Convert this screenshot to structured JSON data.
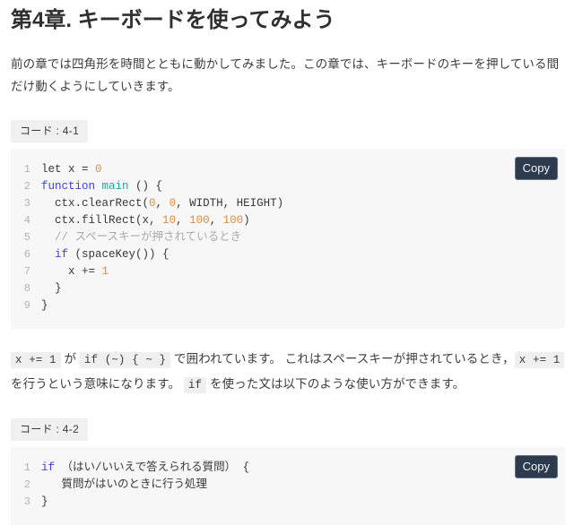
{
  "page": {
    "chapter_title": "第4章. キーボードを使ってみよう",
    "intro_paragraph": "前の章では四角形を時間とともに動かしてみました。この章では、キーボードのキーを押している間だけ動くようにしていきます。"
  },
  "code_blocks": [
    {
      "caption": "コード : 4-1",
      "copy_label": "Copy",
      "lines": [
        {
          "number": "1",
          "tokens": [
            {
              "text": "let x = ",
              "type": "plain"
            },
            {
              "text": "0",
              "type": "number"
            }
          ]
        },
        {
          "number": "2",
          "tokens": [
            {
              "text": "function",
              "type": "keyword"
            },
            {
              "text": " ",
              "type": "plain"
            },
            {
              "text": "main",
              "type": "function"
            },
            {
              "text": " () {",
              "type": "plain"
            }
          ]
        },
        {
          "number": "3",
          "tokens": [
            {
              "text": "  ctx.clearRect(",
              "type": "plain"
            },
            {
              "text": "0",
              "type": "number"
            },
            {
              "text": ", ",
              "type": "plain"
            },
            {
              "text": "0",
              "type": "number"
            },
            {
              "text": ", WIDTH, HEIGHT)",
              "type": "plain"
            }
          ]
        },
        {
          "number": "4",
          "tokens": [
            {
              "text": "  ctx.fillRect(x, ",
              "type": "plain"
            },
            {
              "text": "10",
              "type": "number"
            },
            {
              "text": ", ",
              "type": "plain"
            },
            {
              "text": "100",
              "type": "number"
            },
            {
              "text": ", ",
              "type": "plain"
            },
            {
              "text": "100",
              "type": "number"
            },
            {
              "text": ")",
              "type": "plain"
            }
          ]
        },
        {
          "number": "5",
          "tokens": [
            {
              "text": "  // スペースキーが押されているとき",
              "type": "comment"
            }
          ]
        },
        {
          "number": "6",
          "tokens": [
            {
              "text": "  ",
              "type": "plain"
            },
            {
              "text": "if",
              "type": "keyword"
            },
            {
              "text": " (spaceKey()) {",
              "type": "plain"
            }
          ]
        },
        {
          "number": "7",
          "tokens": [
            {
              "text": "    x += ",
              "type": "plain"
            },
            {
              "text": "1",
              "type": "number"
            }
          ]
        },
        {
          "number": "8",
          "tokens": [
            {
              "text": "  }",
              "type": "plain"
            }
          ]
        },
        {
          "number": "9",
          "tokens": [
            {
              "text": "}",
              "type": "plain"
            }
          ]
        }
      ]
    },
    {
      "caption": "コード : 4-2",
      "copy_label": "Copy",
      "lines": [
        {
          "number": "1",
          "tokens": [
            {
              "text": "if",
              "type": "keyword"
            },
            {
              "text": " （はい/いいえで答えられる質問） {",
              "type": "plain"
            }
          ]
        },
        {
          "number": "2",
          "tokens": [
            {
              "text": "   質問がはいのときに行う処理",
              "type": "plain"
            }
          ]
        },
        {
          "number": "3",
          "tokens": [
            {
              "text": "}",
              "type": "plain"
            }
          ]
        }
      ]
    }
  ],
  "body_paragraph": {
    "segments": [
      {
        "text": "x += 1",
        "type": "code"
      },
      {
        "text": " が ",
        "type": "text"
      },
      {
        "text": "if (~) { ~ }",
        "type": "code"
      },
      {
        "text": " で囲われています。 これはスペースキーが押されているとき，",
        "type": "text"
      },
      {
        "text": "x += 1",
        "type": "code"
      },
      {
        "text": " を行うという意味になります。 ",
        "type": "text"
      },
      {
        "text": "if",
        "type": "code"
      },
      {
        "text": " を使った文は以下のような使い方ができます。",
        "type": "text"
      }
    ]
  },
  "colors": {
    "page_background": "#ffffff",
    "code_background": "#f7f7f7",
    "caption_background": "#f0f0f0",
    "inline_code_background": "#efefef",
    "copy_button_background": "#2e3b4e",
    "keyword": "#3b40e8",
    "function_name": "#1fa8a0",
    "number_literal": "#e08c3b",
    "comment": "#a9a9a9",
    "line_number": "#b3b3b3",
    "text": "#3c3c3c"
  }
}
